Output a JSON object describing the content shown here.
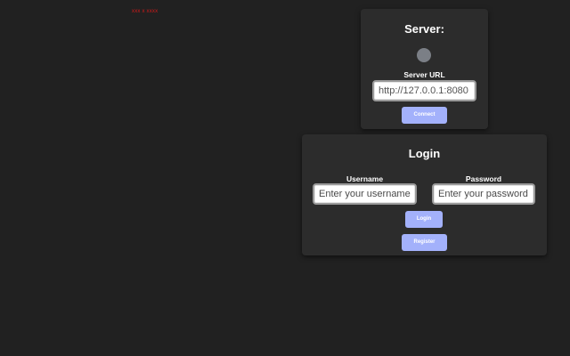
{
  "error": {
    "text": "xxx x xxxx",
    "color": "#d11a1a"
  },
  "server": {
    "title": "Server:",
    "status_color": "#7b7f86",
    "url_label": "Server URL",
    "url_value": "http://127.0.0.1:8080",
    "connect_label": "Connect"
  },
  "login": {
    "title": "Login",
    "username_label": "Username",
    "username_placeholder": "Enter your username",
    "username_value": "",
    "password_label": "Password",
    "password_placeholder": "Enter your password",
    "password_value": "",
    "login_label": "Login",
    "register_label": "Register"
  },
  "colors": {
    "background": "#212121",
    "card": "#2c2c2c",
    "button": "#a3b1fb"
  }
}
